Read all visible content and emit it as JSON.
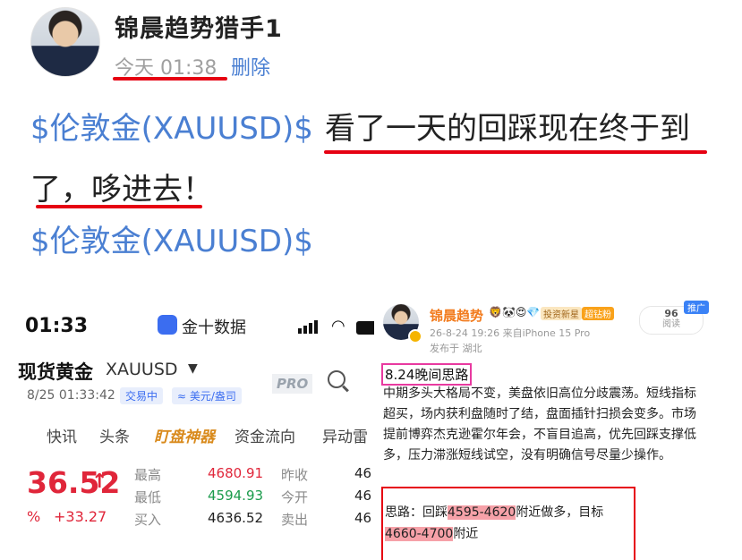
{
  "post": {
    "author": "锦晨趋势猎手1",
    "time": "今天 01:38",
    "delete_label": "删除",
    "line1_link": "$伦敦金(XAUUSD)$",
    "line1_text": "看了一天的回踩现在终于到",
    "line2_text": "了，哆进去！",
    "line3_link": "$伦敦金(XAUUSD)$"
  },
  "left_shot": {
    "clock": "01:33",
    "app_name": "金十数据",
    "title": "现货黄金",
    "symbol": "XAUUSD",
    "datetime": "8/25 01:33:42",
    "status_chip": "交易中",
    "unit_chip": "≈ 美元/盎司",
    "pro_badge": "PRO",
    "tabs": [
      "快讯",
      "头条",
      "盯盘神器",
      "资金流向",
      "异动雷"
    ],
    "price": "36.52",
    "change_pct": "%",
    "change": "+33.27",
    "stats": [
      {
        "label": "最高",
        "value": "4680.91",
        "label2": "昨收",
        "value2": "46"
      },
      {
        "label": "最低",
        "value": "4594.93",
        "label2": "今开",
        "value2": "46"
      },
      {
        "label": "买入",
        "value": "4636.52",
        "label2": "卖出",
        "value2": "46"
      }
    ]
  },
  "right_shot": {
    "author": "锦晨趋势",
    "badges": [
      "投资新星",
      "超钻粉"
    ],
    "meta": "26-8-24 19:26  来自iPhone 15 Pro",
    "location": "发布于 湖北",
    "read_count": "96",
    "read_label": "阅读",
    "promo_chip": "推广",
    "heading": "8.24晚间思路",
    "paragraph": "中期多头大格局不变，美盘依旧高位分歧震荡。短线指标超买，场内获利盘随时了结，盘面插针扫损会变多。市场提前博弈杰克逊霍尔年会，不盲目追高，优先回踩支撑低多，压力滞涨短线试空，没有明确信号尽量少操作。",
    "idea_prefix": "思路：回踩",
    "idea_range": "4595-4620",
    "idea_mid": "附近做多，目标",
    "target_range": "4660-4700",
    "target_suffix": "附近"
  }
}
